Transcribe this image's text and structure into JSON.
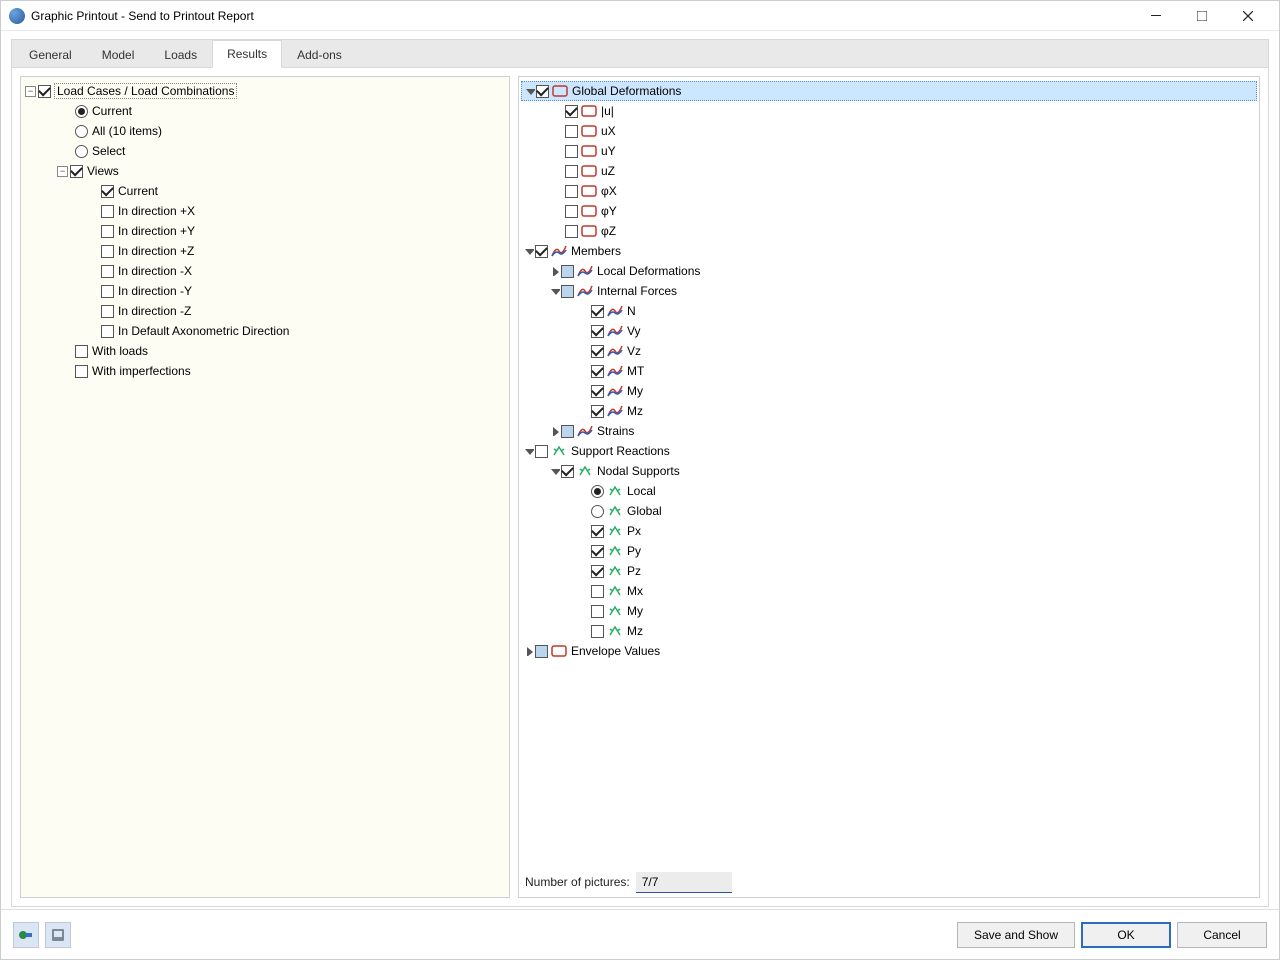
{
  "window": {
    "title": "Graphic Printout - Send to Printout Report"
  },
  "tabs": {
    "general": "General",
    "model": "Model",
    "loads": "Loads",
    "results": "Results",
    "addons": "Add-ons"
  },
  "left": {
    "load_cases": "Load Cases / Load Combinations",
    "current": "Current",
    "all": "All (10 items)",
    "select": "Select",
    "views": "Views",
    "v_current": "Current",
    "v_px": "In direction +X",
    "v_py": "In direction +Y",
    "v_pz": "In direction +Z",
    "v_mx": "In direction -X",
    "v_my": "In direction -Y",
    "v_mz": "In direction -Z",
    "v_axo": "In Default Axonometric Direction",
    "with_loads": "With loads",
    "with_imperf": "With imperfections"
  },
  "right": {
    "global_def": "Global Deformations",
    "u": "|u|",
    "ux": "uX",
    "uy": "uY",
    "uz": "uZ",
    "phx": "φX",
    "phy": "φY",
    "phz": "φZ",
    "members": "Members",
    "local_def": "Local Deformations",
    "internal_forces": "Internal Forces",
    "n": "N",
    "vy": "Vy",
    "vz": "Vz",
    "mt": "MT",
    "my": "My",
    "mz": "Mz",
    "strains": "Strains",
    "support": "Support Reactions",
    "nodal": "Nodal Supports",
    "local": "Local",
    "global": "Global",
    "px": "Px",
    "py": "Py",
    "pz": "Pz",
    "mx": "Mx",
    "myy": "My",
    "mzz": "Mz",
    "envelope": "Envelope Values",
    "num_pic_label": "Number of pictures:",
    "num_pic_value": "7/7"
  },
  "buttons": {
    "save": "Save and Show",
    "ok": "OK",
    "cancel": "Cancel"
  }
}
